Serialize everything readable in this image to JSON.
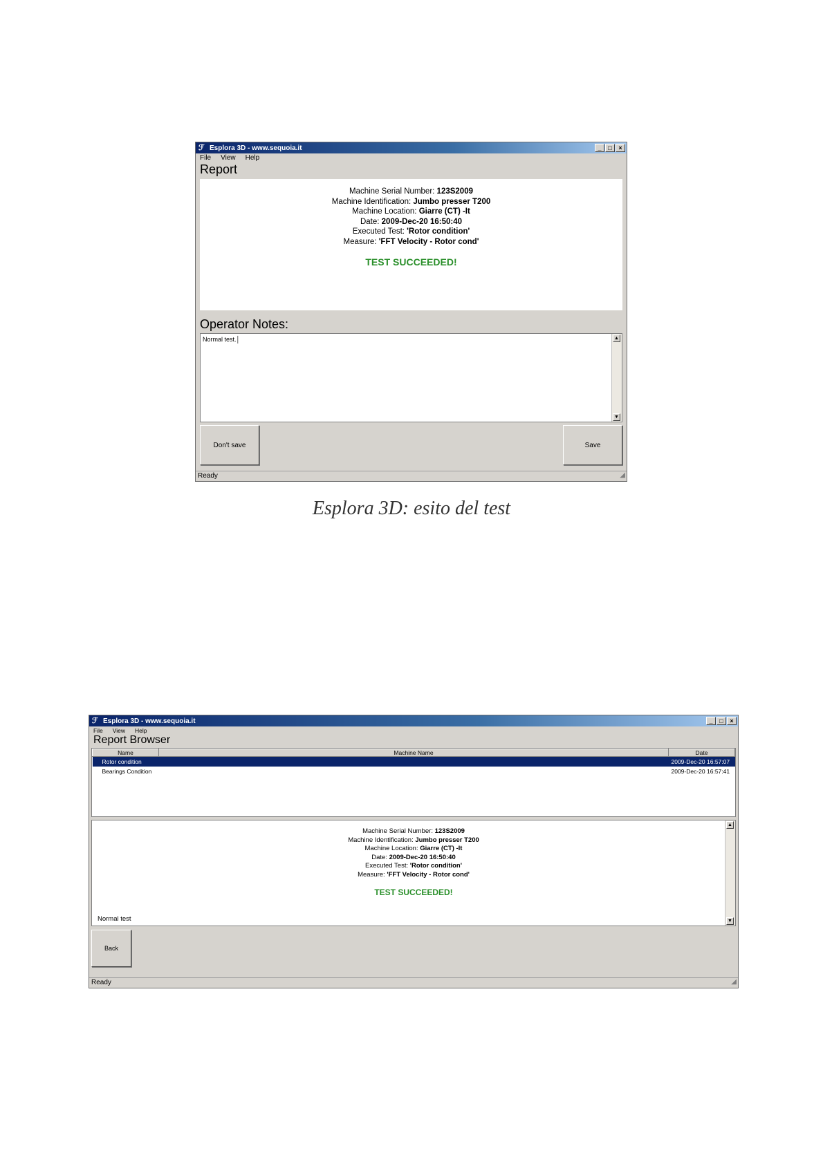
{
  "window1": {
    "title": "Esplora 3D - www.sequoia.it",
    "menu": [
      "File",
      "View",
      "Help"
    ],
    "controls": [
      "_",
      "□",
      "×"
    ],
    "report_heading": "Report",
    "info": [
      {
        "label": "Machine Serial Number: ",
        "value": "123S2009"
      },
      {
        "label": "Machine Identification: ",
        "value": "Jumbo presser T200"
      },
      {
        "label": "Machine Location: ",
        "value": "Giarre (CT) -It"
      },
      {
        "label": "Date: ",
        "value": "2009-Dec-20 16:50:40"
      },
      {
        "label": "Executed Test: ",
        "value": "'Rotor condition'"
      },
      {
        "label": "Measure: ",
        "value": "'FFT Velocity - Rotor cond'"
      }
    ],
    "result": "TEST SUCCEEDED!",
    "notes_heading": "Operator Notes:",
    "notes_value": "Normal test.",
    "dont_save_label": "Don't save",
    "save_label": "Save",
    "status": "Ready"
  },
  "caption": "Esplora 3D: esito del test",
  "window2": {
    "title": "Esplora 3D - www.sequoia.it",
    "menu": [
      "File",
      "View",
      "Help"
    ],
    "controls": [
      "_",
      "□",
      "×"
    ],
    "heading": "Report Browser",
    "columns": [
      "Name",
      "Machine Name",
      "Date"
    ],
    "rows": [
      {
        "name": "Rotor condition",
        "machine": "",
        "date": "2009-Dec-20 16:57:07",
        "selected": true
      },
      {
        "name": "Bearings Condition",
        "machine": "",
        "date": "2009-Dec-20 16:57:41",
        "selected": false
      }
    ],
    "info": [
      {
        "label": "Machine Serial Number: ",
        "value": "123S2009"
      },
      {
        "label": "Machine Identification: ",
        "value": "Jumbo presser T200"
      },
      {
        "label": "Machine Location: ",
        "value": "Giarre (CT) -It"
      },
      {
        "label": "Date: ",
        "value": "2009-Dec-20 16:50:40"
      },
      {
        "label": "Executed Test: ",
        "value": "'Rotor condition'"
      },
      {
        "label": "Measure: ",
        "value": "'FFT Velocity - Rotor cond'"
      }
    ],
    "result": "TEST SUCCEEDED!",
    "notes_value": "Normal test",
    "back_label": "Back",
    "status": "Ready"
  },
  "colors": {
    "success": "#2a8f2a",
    "titlebar": "#0a246a",
    "selection": "#0a246a"
  }
}
